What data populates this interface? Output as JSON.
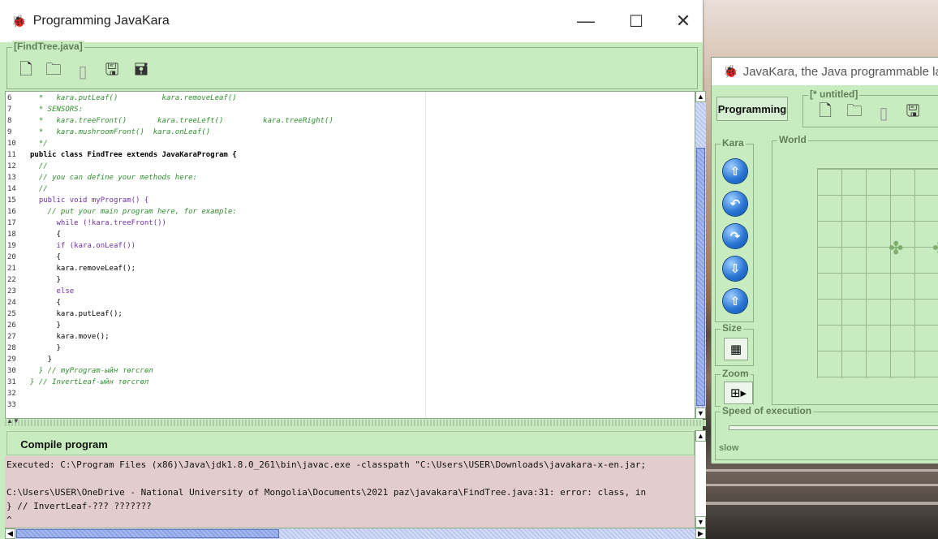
{
  "editor_window": {
    "title": "Programming JavaKara",
    "controls": {
      "minimize": "—",
      "maximize": "☐",
      "close": "✕"
    },
    "file_tab": "[FindTree.java]",
    "toolbar": [
      "new-file",
      "open-folder",
      "save-gray",
      "save",
      "save-as"
    ]
  },
  "code": [
    {
      "n": "6",
      "t": "  *   kara.putLeaf()          kara.removeLeaf()",
      "cls": "cmt"
    },
    {
      "n": "7",
      "t": "  * SENSORS:",
      "cls": "cmt"
    },
    {
      "n": "8",
      "t": "  *   kara.treeFront()       kara.treeLeft()         kara.treeRight()",
      "cls": "cmt"
    },
    {
      "n": "9",
      "t": "  *   kara.mushroomFront()  kara.onLeaf()",
      "cls": "cmt"
    },
    {
      "n": "10",
      "t": "  */",
      "cls": "cmt"
    },
    {
      "n": "11",
      "t": "public class FindTree extends JavaKaraProgram {",
      "cls": "cls"
    },
    {
      "n": "12",
      "t": "  //",
      "cls": "cmt"
    },
    {
      "n": "13",
      "t": "  // you can define your methods here:",
      "cls": "cmt"
    },
    {
      "n": "14",
      "t": "  //",
      "cls": "cmt"
    },
    {
      "n": "15",
      "t": "  public void myProgram() {",
      "cls": "kw"
    },
    {
      "n": "16",
      "t": "    // put your main program here, for example:",
      "cls": "cmt"
    },
    {
      "n": "17",
      "t": "      while (!kara.treeFront())",
      "cls": "kw"
    },
    {
      "n": "18",
      "t": "      {",
      "cls": ""
    },
    {
      "n": "19",
      "t": "      if (kara.onLeaf())",
      "cls": "kw"
    },
    {
      "n": "20",
      "t": "      {",
      "cls": ""
    },
    {
      "n": "21",
      "t": "      kara.removeLeaf();",
      "cls": ""
    },
    {
      "n": "22",
      "t": "      }",
      "cls": ""
    },
    {
      "n": "23",
      "t": "      else",
      "cls": "kw"
    },
    {
      "n": "24",
      "t": "      {",
      "cls": ""
    },
    {
      "n": "25",
      "t": "      kara.putLeaf();",
      "cls": ""
    },
    {
      "n": "26",
      "t": "      }",
      "cls": ""
    },
    {
      "n": "27",
      "t": "      kara.move();",
      "cls": ""
    },
    {
      "n": "28",
      "t": "      }",
      "cls": ""
    },
    {
      "n": "29",
      "t": "    }",
      "cls": ""
    },
    {
      "n": "30",
      "t": "  } // myProgram-ыйн төгсгөл",
      "cls": "cmt"
    },
    {
      "n": "31",
      "t": "} // InvertLeaf-ыйн төгсгөл",
      "cls": "cmt"
    },
    {
      "n": "32",
      "t": "",
      "cls": ""
    },
    {
      "n": "33",
      "t": "",
      "cls": ""
    }
  ],
  "compile": {
    "button_label": "Compile program"
  },
  "console": [
    "Executed: C:\\Program Files (x86)\\Java\\jdk1.8.0_261\\bin\\javac.exe -classpath \"C:\\Users\\USER\\Downloads\\javakara-x-en.jar;",
    "",
    "C:\\Users\\USER\\OneDrive - National University of Mongolia\\Documents\\2021 paz\\javakara\\FindTree.java:31: error: class, in",
    "} // InvertLeaf-??? ???????",
    "^"
  ],
  "world_window": {
    "title": "JavaKara, the Java programmable la",
    "file_tab": "[* untitled]",
    "programming_button": "Programming",
    "kara_label": "Kara",
    "world_label": "World",
    "size_label": "Size",
    "zoom_label": "Zoom",
    "speed_label": "Speed of execution",
    "speed_value": "slow",
    "kara_buttons": [
      "move-up-icon",
      "turn-left-icon",
      "turn-right-icon",
      "put-leaf-icon",
      "remove-leaf-icon"
    ]
  }
}
